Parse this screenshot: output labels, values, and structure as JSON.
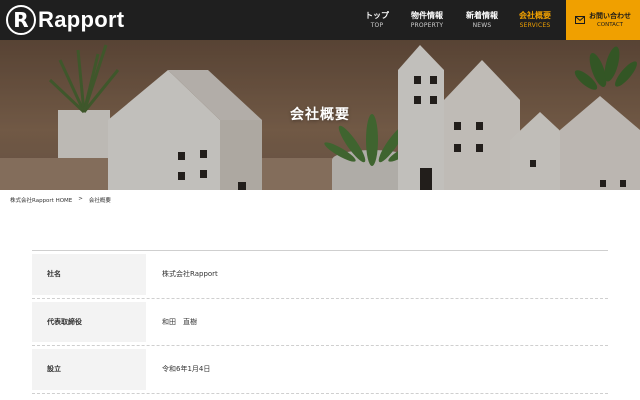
{
  "header": {
    "logo_letter": "R",
    "logo_text": "Rapport",
    "nav": [
      {
        "jp": "トップ",
        "en": "TOP"
      },
      {
        "jp": "物件情報",
        "en": "PROPERTY"
      },
      {
        "jp": "新着情報",
        "en": "NEWS"
      },
      {
        "jp": "会社概要",
        "en": "SERVICES"
      }
    ],
    "contact": {
      "jp": "お問い合わせ",
      "en": "CONTACT",
      "icon": "mail-icon"
    },
    "colors": {
      "background": "#1f1f1f",
      "accent": "#f0a000"
    }
  },
  "hero": {
    "title": "会社概要"
  },
  "breadcrumb": {
    "home": "株式会社Rapport HOME",
    "separator": ">",
    "current": "会社概要"
  },
  "company_info": [
    {
      "label": "社名",
      "value": "株式会社Rapport"
    },
    {
      "label": "代表取締役",
      "value": "和田　直樹"
    },
    {
      "label": "設立",
      "value": "令和6年1月4日"
    }
  ]
}
